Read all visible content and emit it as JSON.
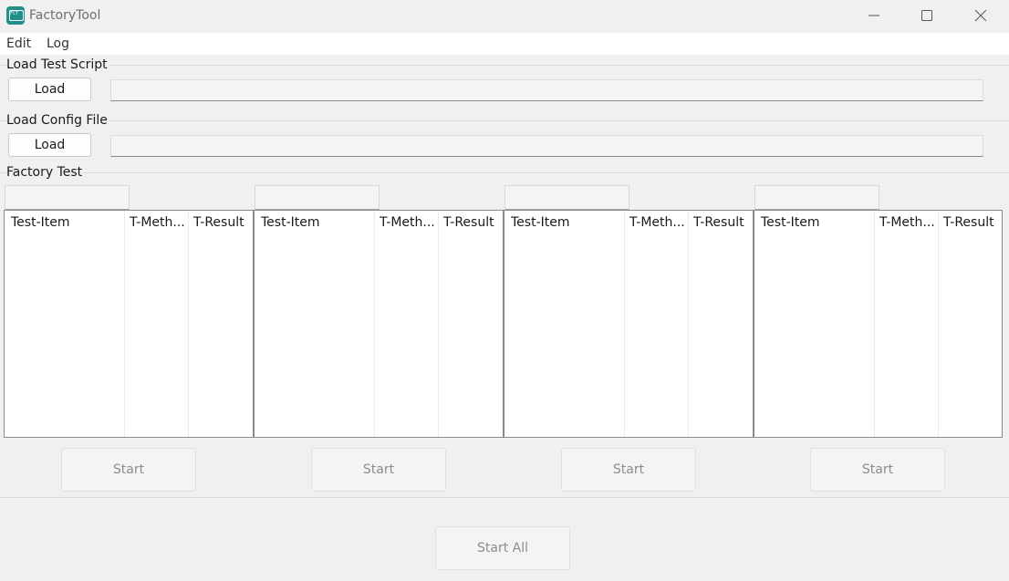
{
  "window": {
    "title": "FactoryTool",
    "icon": "factorytool-app-icon",
    "icon_text": "FCT",
    "controls": [
      "minimize-icon",
      "maximize-icon",
      "close-icon"
    ]
  },
  "menu": {
    "items": [
      "Edit",
      "Log"
    ]
  },
  "test_script": {
    "label": "Load Test Script",
    "button_label": "Load",
    "path_value": ""
  },
  "config_file": {
    "label": "Load Config File",
    "button_label": "Load",
    "path_value": ""
  },
  "factory_test": {
    "label": "Factory Test",
    "slots": [
      {
        "field_value": "",
        "columns": [
          "Test-Item",
          "T-Meth...",
          "T-Result"
        ],
        "rows": [],
        "start_label": "Start"
      },
      {
        "field_value": "",
        "columns": [
          "Test-Item",
          "T-Meth...",
          "T-Result"
        ],
        "rows": [],
        "start_label": "Start"
      },
      {
        "field_value": "",
        "columns": [
          "Test-Item",
          "T-Meth...",
          "T-Result"
        ],
        "rows": [],
        "start_label": "Start"
      },
      {
        "field_value": "",
        "columns": [
          "Test-Item",
          "T-Meth...",
          "T-Result"
        ],
        "rows": [],
        "start_label": "Start"
      }
    ],
    "start_all_label": "Start All"
  },
  "colors": {
    "window_bg": "#f0f0f0",
    "menubar_bg": "#ffffff",
    "icon_teal": "#1f8f8a",
    "disabled_text": "#8c8c8c"
  }
}
